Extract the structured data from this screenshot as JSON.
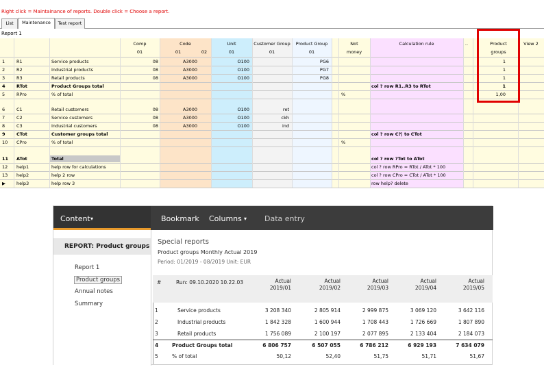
{
  "hint": "Right click = Maintainance of reports. Double click = Choose a report.",
  "tabs": [
    "List",
    "Maintenance",
    "Test report"
  ],
  "sheet_label": "Report 1",
  "grid": {
    "headers": {
      "comp": "Comp",
      "comp_sub": "01",
      "code": "Code",
      "code_sub1": "01",
      "code_sub2": "02",
      "unit": "Unit",
      "unit_sub": "01",
      "custgroup": "Customer Group",
      "custgroup_sub": "01",
      "prodgroup": "Product Group",
      "prodgroup_sub": "01",
      "not": "Not",
      "not_sub": "money",
      "calc": "Calculation rule",
      "dots": "..",
      "product": "Product",
      "product_sub": "groups",
      "view": "View 2"
    },
    "rows": [
      {
        "n": "1",
        "id": "R1",
        "name": "Service products",
        "comp": "08",
        "code": "A3000",
        "unit": "O100",
        "cust": "",
        "prod": "PG6",
        "not": "",
        "calc": "",
        "pg": "1",
        "bold": false
      },
      {
        "n": "2",
        "id": "R2",
        "name": "Industrial products",
        "comp": "08",
        "code": "A3000",
        "unit": "O100",
        "cust": "",
        "prod": "PG7",
        "not": "",
        "calc": "",
        "pg": "1",
        "bold": false
      },
      {
        "n": "3",
        "id": "R3",
        "name": "Retail products",
        "comp": "08",
        "code": "A3000",
        "unit": "O100",
        "cust": "",
        "prod": "PG8",
        "not": "",
        "calc": "",
        "pg": "1",
        "bold": false
      },
      {
        "n": "4",
        "id": "RTot",
        "name": "Product Groups total",
        "comp": "",
        "code": "",
        "unit": "",
        "cust": "",
        "prod": "",
        "not": "",
        "calc": "col ? row R1..R3 to RTot",
        "pg": "1",
        "bold": true
      },
      {
        "n": "5",
        "id": "RPro",
        "name": "% of total",
        "comp": "",
        "code": "",
        "unit": "",
        "cust": "",
        "prod": "",
        "not": "%",
        "calc": "",
        "pg": "1,00",
        "bold": false
      },
      {
        "n": "6",
        "id": "C1",
        "name": "Retail customers",
        "comp": "08",
        "code": "A3000",
        "unit": "O100",
        "cust": "ret",
        "prod": "",
        "not": "",
        "calc": "",
        "pg": "",
        "bold": false
      },
      {
        "n": "7",
        "id": "C2",
        "name": "Service customers",
        "comp": "08",
        "code": "A3000",
        "unit": "O100",
        "cust": "ckh",
        "prod": "",
        "not": "",
        "calc": "",
        "pg": "",
        "bold": false
      },
      {
        "n": "8",
        "id": "C3",
        "name": "Industrial customers",
        "comp": "08",
        "code": "A3000",
        "unit": "O100",
        "cust": "ind",
        "prod": "",
        "not": "",
        "calc": "",
        "pg": "",
        "bold": false
      },
      {
        "n": "9",
        "id": "CTot",
        "name": "Customer groups total",
        "comp": "",
        "code": "",
        "unit": "",
        "cust": "",
        "prod": "",
        "not": "",
        "calc": "col ? row C?| to CTot",
        "pg": "",
        "bold": true
      },
      {
        "n": "10",
        "id": "CPro",
        "name": "% of total",
        "comp": "",
        "code": "",
        "unit": "",
        "cust": "",
        "prod": "",
        "not": "%",
        "calc": "",
        "pg": "",
        "bold": false
      },
      {
        "n": "11",
        "id": "ATot",
        "name": "Total",
        "comp": "",
        "code": "",
        "unit": "",
        "cust": "",
        "prod": "",
        "not": "",
        "calc": "col ? row ?Tot to ATot",
        "pg": "",
        "bold": true
      },
      {
        "n": "12",
        "id": "help1",
        "name": "help row for calculations",
        "comp": "",
        "code": "",
        "unit": "",
        "cust": "",
        "prod": "",
        "not": "",
        "calc": "col ? row RPro = RTot / ATot * 100",
        "pg": "",
        "bold": false
      },
      {
        "n": "13",
        "id": "help2",
        "name": "help 2 row",
        "comp": "",
        "code": "",
        "unit": "",
        "cust": "",
        "prod": "",
        "not": "",
        "calc": "col ? row CPro = CTot / ATot * 100",
        "pg": "",
        "bold": false
      },
      {
        "n": "▶",
        "id": "help3",
        "name": "help row 3",
        "comp": "",
        "code": "",
        "unit": "",
        "cust": "",
        "prod": "",
        "not": "",
        "calc": "row help? delete",
        "pg": "",
        "bold": false
      }
    ]
  },
  "nav": {
    "content": "Content",
    "bookmark": "Bookmark",
    "columns": "Columns",
    "data_entry": "Data entry",
    "caret": "▾"
  },
  "left": {
    "heading": "REPORT: Product groups",
    "items": [
      "Report 1",
      "Product groups",
      "Annual notes",
      "Summary"
    ]
  },
  "report": {
    "title": "Special reports",
    "subtitle": "Product groups Monthly Actual 2019",
    "period": "Period: 01/2019 - 08/2019 Unit: EUR",
    "hash": "#",
    "run": "Run: 09.10.2020 10.22.03",
    "columns": [
      {
        "a": "Actual",
        "b": "2019/01"
      },
      {
        "a": "Actual",
        "b": "2019/02"
      },
      {
        "a": "Actual",
        "b": "2019/03"
      },
      {
        "a": "Actual",
        "b": "2019/04"
      },
      {
        "a": "Actual",
        "b": "2019/05"
      }
    ],
    "rows": [
      {
        "n": "1",
        "label": "Service products",
        "v": [
          "3 208 340",
          "2 805 914",
          "2 999 875",
          "3 069 120",
          "3 642 116"
        ],
        "bold": false,
        "indent": true
      },
      {
        "n": "2",
        "label": "Industrial products",
        "v": [
          "1 842 328",
          "1 600 944",
          "1 708 443",
          "1 726 669",
          "1 807 890"
        ],
        "bold": false,
        "indent": true
      },
      {
        "n": "3",
        "label": "Retail products",
        "v": [
          "1 756 089",
          "2 100 197",
          "2 077 895",
          "2 133 404",
          "2 184 073"
        ],
        "bold": false,
        "indent": true
      },
      {
        "n": "4",
        "label": "Product Groups total",
        "v": [
          "6 806 757",
          "6 507 055",
          "6 786 212",
          "6 929 193",
          "7 634 079"
        ],
        "bold": true,
        "indent": false
      },
      {
        "n": "5",
        "label": "% of total",
        "v": [
          "50,12",
          "52,40",
          "51,75",
          "51,71",
          "51,67"
        ],
        "bold": false,
        "indent": false
      }
    ]
  }
}
